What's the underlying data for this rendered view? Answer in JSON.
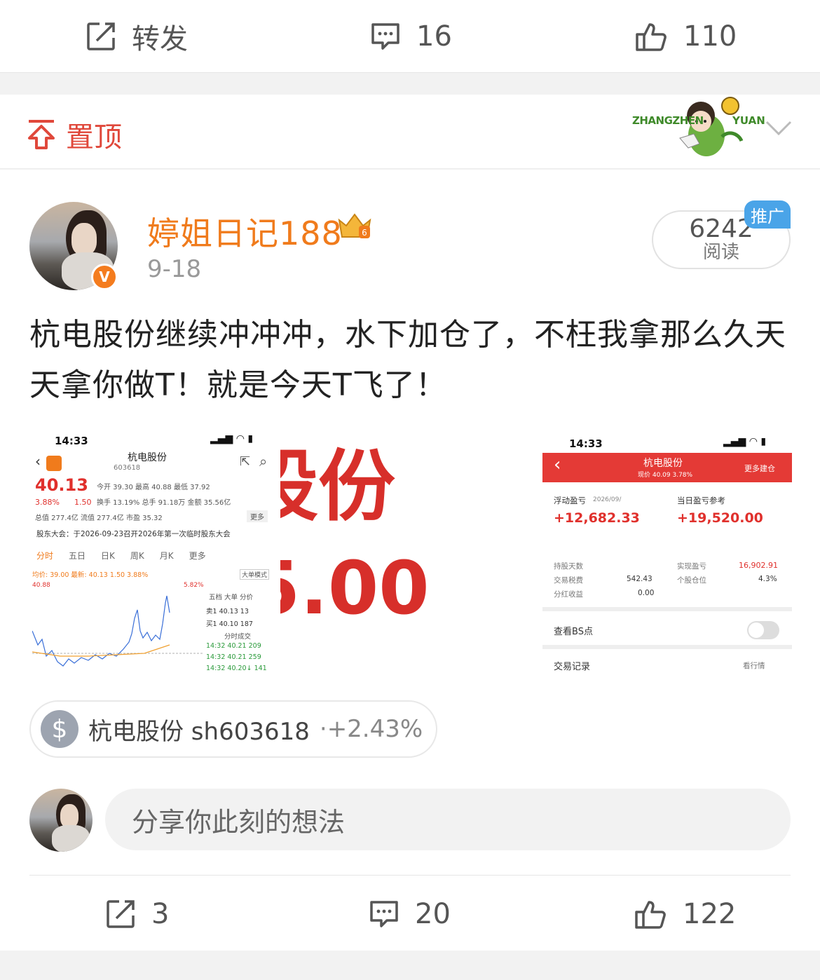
{
  "top_actions": {
    "repost_label": "转发",
    "comments": "16",
    "likes": "110"
  },
  "pinned": {
    "label": "置顶",
    "badge_text_left": "ZHANGZHEN",
    "badge_text_right": "YUAN"
  },
  "post": {
    "username": "婷姐日记188",
    "date": "9-18",
    "reads": "6242",
    "reads_label": "阅读",
    "promo_label": "推广",
    "text": "杭电股份继续冲冲冲，水下加仓了，不枉我拿那么久天天拿你做T！就是今天T飞了！",
    "stock_chip": {
      "name": "杭电股份 sh603618",
      "sep": "·",
      "change": "+2.43%"
    },
    "comment_placeholder": "分享你此刻的想法"
  },
  "bottom_actions": {
    "reposts": "3",
    "comments": "20",
    "likes": "122"
  },
  "screenshot_left": {
    "time": "14:33",
    "stock_name": "杭电股份",
    "stock_code": "603618",
    "price": "40.13",
    "pct": "3.88%",
    "chg": "1.50",
    "stats_row1": "今开  39.30  最高  40.88  最低  37.92",
    "stats_row2": "换手  13.19%  总手  91.18万  金额  35.56亿",
    "stats_row3": "总值  277.4亿  流值  277.4亿  市盈  35.32",
    "more": "更多",
    "notice": "股东大会：于2026-09-23召开2026年第一次临时股东大会",
    "tabs": [
      "分时",
      "五日",
      "日K",
      "周K",
      "月K",
      "更多"
    ],
    "avg_line": "均价: 39.00  最新: 40.13  1.50  3.88%",
    "big_mode": "大单模式",
    "top_price": "40.88",
    "top_pct": "5.82%",
    "side_tabs": "五档  大单  分价",
    "sell1": "卖1   40.13    13",
    "buy1": "买1   40.10   187",
    "trades_title": "分时成交",
    "trades": [
      "14:32  40.21   209",
      "14:32  40.21   259",
      "14:32  40.20↓  141"
    ]
  },
  "screenshot_mid": {
    "text_top": "股份",
    "text_bottom": "5.00"
  },
  "screenshot_right": {
    "time": "14:33",
    "title": "杭电股份",
    "subtitle": "现价 40.09 3.78%",
    "more_btn": "更多建仓",
    "float_label": "浮动盈亏",
    "float_date": "2026/09/",
    "day_label": "当日盈亏参考",
    "float_value": "+12,682.33",
    "day_value": "+19,520.00",
    "hold_days_label": "持股天数",
    "tax_label": "交易税费",
    "tax_value": "542.43",
    "div_label": "分红收益",
    "div_value": "0.00",
    "realized_label": "实现盈亏",
    "realized_value": "16,902.91",
    "position_label": "个股仓位",
    "position_value": "4.3%",
    "bs_label": "查看BS点",
    "trade_log": "交易记录",
    "market_link": "看行情"
  }
}
